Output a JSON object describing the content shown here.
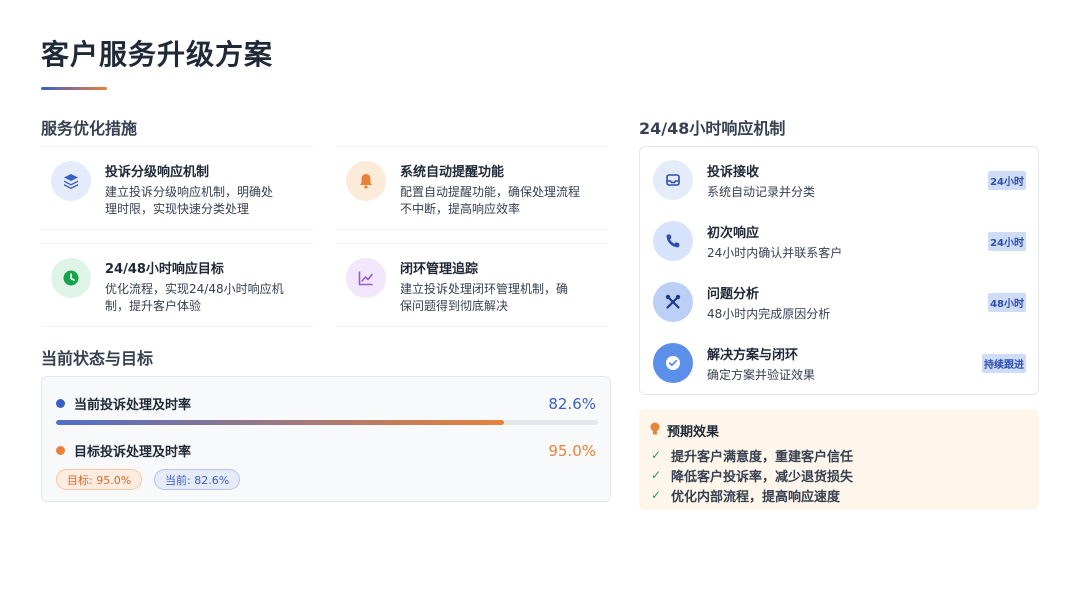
{
  "page": {
    "title": "客户服务升级方案"
  },
  "colors": {
    "accent_blue": "#3b5fc4",
    "accent_orange": "#e8823a",
    "success_green": "#22a065"
  },
  "measures": {
    "section_title": "服务优化措施",
    "items": [
      {
        "icon": "layers-icon",
        "title": "投诉分级响应机制",
        "desc_line1": "建立投诉分级响应机制，明确处",
        "desc_line2": "理时限，实现快速分类处理"
      },
      {
        "icon": "bell-icon",
        "title": "系统自动提醒功能",
        "desc_line1": "配置自动提醒功能，确保处理流程",
        "desc_line2": "不中断，提高响应效率"
      },
      {
        "icon": "clock-icon",
        "title": "24/48小时响应目标",
        "desc_line1": "优化流程，实现24/48小时响应机",
        "desc_line2": "制，提升客户体验"
      },
      {
        "icon": "trend-chart-icon",
        "title": "闭环管理追踪",
        "desc_line1": "建立投诉处理闭环管理机制，确",
        "desc_line2": "保问题得到彻底解决"
      }
    ]
  },
  "status": {
    "section_title": "当前状态与目标",
    "current": {
      "label": "当前投诉处理及时率",
      "value": "82.6%",
      "fraction": 0.826
    },
    "target": {
      "label": "目标投诉处理及时率",
      "value": "95.0%",
      "fraction": 0.95
    },
    "chip_target": "目标: 95.0%",
    "chip_current": "当前: 82.6%"
  },
  "response": {
    "section_title": "24/48小时响应机制",
    "steps": [
      {
        "icon": "inbox-icon",
        "title": "投诉接收",
        "desc": "系统自动记录并分类",
        "badge": "24小时"
      },
      {
        "icon": "phone-icon",
        "title": "初次响应",
        "desc": "24小时内确认并联系客户",
        "badge": "24小时"
      },
      {
        "icon": "tools-icon",
        "title": "问题分析",
        "desc": "48小时内完成原因分析",
        "badge": "48小时"
      },
      {
        "icon": "check-circle-icon",
        "title": "解决方案与闭环",
        "desc": "确定方案并验证效果",
        "badge": "持续跟进"
      }
    ]
  },
  "effects": {
    "title": "预期效果",
    "items": [
      "提升客户满意度，重建客户信任",
      "降低客户投诉率，减少退货损失",
      "优化内部流程，提高响应速度"
    ]
  }
}
